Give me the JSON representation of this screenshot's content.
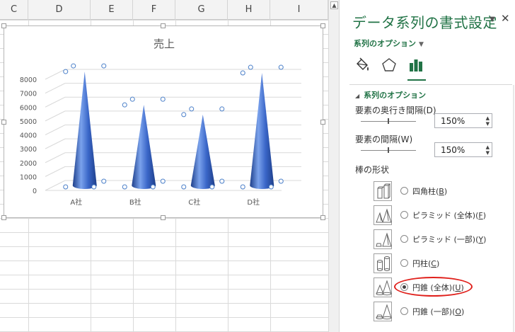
{
  "spreadsheet": {
    "columns": [
      "C",
      "D",
      "E",
      "F",
      "G",
      "H",
      "I"
    ]
  },
  "chart_data": {
    "type": "bar",
    "title": "売上",
    "categories": [
      "A社",
      "B社",
      "C社",
      "D社"
    ],
    "values": [
      8200,
      5800,
      5100,
      8100
    ],
    "ylim": [
      0,
      8000
    ],
    "yticks": [
      0,
      1000,
      2000,
      3000,
      4000,
      5000,
      6000,
      7000,
      8000
    ],
    "shape": "cone",
    "grid": true,
    "colors": {
      "bar": "#3a66c8",
      "bar_light": "#7aa2ec",
      "bar_dark": "#1e3f8a"
    }
  },
  "format_pane": {
    "title": "データ系列の書式設定",
    "dropdown_icon": "dropdown-arrow-icon",
    "close_icon": "close-icon",
    "menu_label": "系列のオプション",
    "tabs": [
      {
        "name": "fill-line",
        "icon": "paint-bucket-icon"
      },
      {
        "name": "effects",
        "icon": "pentagon-icon"
      },
      {
        "name": "series-options",
        "icon": "bar-chart-icon",
        "selected": true
      }
    ],
    "section_header": "系列のオプション",
    "gap_depth": {
      "label": "要素の奥行き間隔(D)",
      "value": "150%"
    },
    "gap_width": {
      "label": "要素の間隔(W)",
      "value": "150%"
    },
    "shape_label": "棒の形状",
    "shape_options": [
      {
        "label": "四角柱(B)",
        "selected": false
      },
      {
        "label": "ピラミッド (全体)(F)",
        "selected": false
      },
      {
        "label": "ピラミッド (一部)(Y)",
        "selected": false
      },
      {
        "label": "円柱(C)",
        "selected": false
      },
      {
        "label": "円錐 (全体)(U)",
        "selected": true
      },
      {
        "label": "円錐 (一部)(O)",
        "selected": false
      }
    ],
    "accent_color": "#217346",
    "highlight_color": "#e0201b"
  }
}
